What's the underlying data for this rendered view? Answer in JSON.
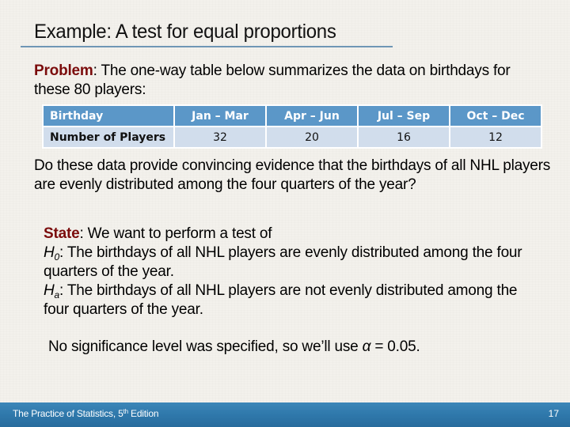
{
  "slide": {
    "title": "Example: A test for equal proportions",
    "problem": {
      "label": "Problem",
      "text": ": The one-way table below summarizes the data on birthdays for these 80 players:"
    },
    "table": {
      "row_header_1": "Birthday",
      "row_header_2": "Number of Players",
      "columns": [
        "Jan – Mar",
        "Apr – Jun",
        "Jul – Sep",
        "Oct – Dec"
      ],
      "values": [
        "32",
        "20",
        "16",
        "12"
      ]
    },
    "question": "Do these data provide convincing evidence that the birthdays of all NHL players are evenly distributed among the four quarters of the year?",
    "state": {
      "label": "State",
      "intro": ": We want to perform a test of",
      "h0_symbol": "H",
      "h0_sub": "0",
      "h0_text": ": The birthdays of all NHL players are evenly distributed among the four quarters of the year.",
      "ha_symbol": "H",
      "ha_sub": "a",
      "ha_text": ": The birthdays of all NHL players are not evenly distributed among the four quarters of the year."
    },
    "significance": {
      "text_before": "No significance level was specified, so we’ll use ",
      "alpha_symbol": "α",
      "text_after": " = 0.05."
    }
  },
  "footer": {
    "book_title_pre": "The Practice of Statistics, 5",
    "book_title_sup": "th",
    "book_title_post": " Edition",
    "page_number": "17"
  }
}
